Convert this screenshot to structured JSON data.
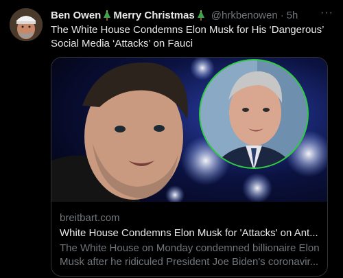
{
  "tweet": {
    "author_name": "Ben Owen",
    "author_suffix": "Merry Christmas",
    "handle": "@hrkbenowen",
    "separator": "·",
    "time": "5h",
    "more": "···",
    "text": "The White House Condemns Elon Musk for His ‘Dangerous’ Social Media ‘Attacks’ on Fauci"
  },
  "card": {
    "domain": "breitbart.com",
    "title": "White House Condemns Elon Musk for 'Attacks' on Ant...",
    "description": "The White House on Monday condemned billionaire Elon Musk after he ridiculed President Joe Biden's coronavir..."
  },
  "colors": {
    "background": "#000000",
    "text_primary": "#e7e9ea",
    "text_secondary": "#71767b",
    "border": "#2f3336",
    "inset_ring": "#2ecc40"
  },
  "icons": [
    "christmas-tree-icon",
    "more-icon"
  ]
}
